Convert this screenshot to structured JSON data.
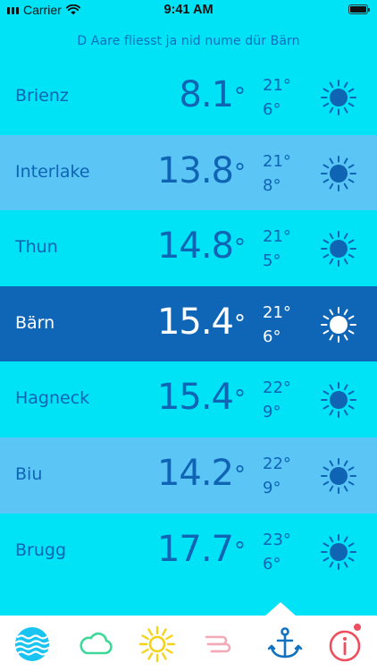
{
  "status_bar": {
    "carrier": "Carrier",
    "time": "9:41 AM"
  },
  "headline": "D Aare fliesst ja nid nume dür Bärn",
  "stations": [
    {
      "name": "Brienz",
      "temp": "8.1",
      "hi": "21°",
      "lo": "6°",
      "icon": "sun-icon",
      "state": "base"
    },
    {
      "name": "Interlake",
      "temp": "13.8",
      "hi": "21°",
      "lo": "8°",
      "icon": "sun-icon",
      "state": "alt"
    },
    {
      "name": "Thun",
      "temp": "14.8",
      "hi": "21°",
      "lo": "5°",
      "icon": "sun-icon",
      "state": "base"
    },
    {
      "name": "Bärn",
      "temp": "15.4",
      "hi": "21°",
      "lo": "6°",
      "icon": "sun-icon",
      "state": "active"
    },
    {
      "name": "Hagneck",
      "temp": "15.4",
      "hi": "22°",
      "lo": "9°",
      "icon": "sun-icon",
      "state": "base"
    },
    {
      "name": "Biu",
      "temp": "14.2",
      "hi": "22°",
      "lo": "9°",
      "icon": "sun-icon",
      "state": "alt"
    },
    {
      "name": "Brugg",
      "temp": "17.7",
      "hi": "23°",
      "lo": "6°",
      "icon": "sun-icon",
      "state": "base"
    }
  ],
  "degree_symbol": "°",
  "tabs": [
    {
      "icon": "water-waves-icon",
      "color": "#19c4f0"
    },
    {
      "icon": "cloud-icon",
      "color": "#3ed89a"
    },
    {
      "icon": "sun-icon",
      "color": "#f4d21a"
    },
    {
      "icon": "wind-icon",
      "color": "#f3aab8"
    },
    {
      "icon": "anchor-icon",
      "color": "#1172bf",
      "selected": true
    },
    {
      "icon": "info-icon",
      "color": "#ef4e5e",
      "badge": true
    }
  ],
  "colors": {
    "background": "#00e2f6",
    "row_alt": "#5bc6f6",
    "row_active": "#0f66b6",
    "text_blue": "#0f64b4",
    "white": "#ffffff"
  }
}
